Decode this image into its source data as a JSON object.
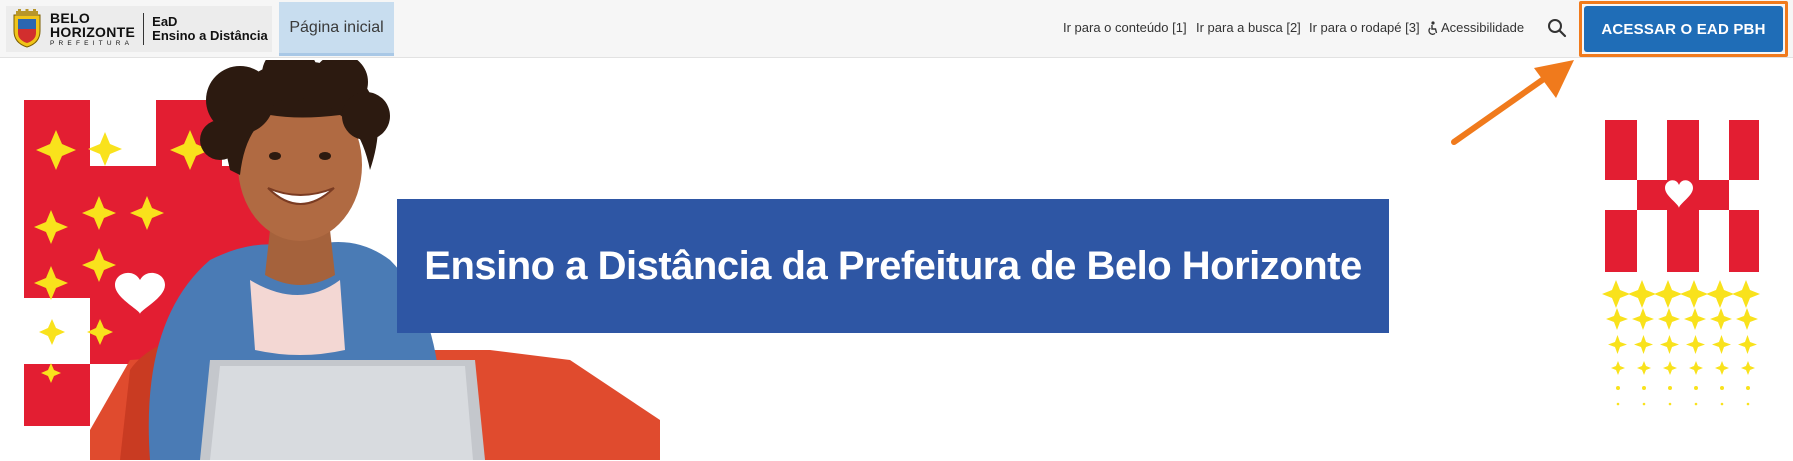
{
  "header": {
    "logo": {
      "org_line1": "BELO",
      "org_line2": "HORIZONTE",
      "org_line3": "PREFEITURA",
      "product_line1": "EaD",
      "product_line2": "Ensino a Distância"
    },
    "home_tab": "Página inicial",
    "quick_links": [
      "Ir para o conteúdo [1]",
      "Ir para a busca [2]",
      "Ir para o rodapé [3]"
    ],
    "accessibility_label": "Acessibilidade",
    "cta_label": "ACESSAR O EAD PBH"
  },
  "hero": {
    "title": "Ensino a Distância da Prefeitura de Belo Horizonte"
  },
  "colors": {
    "accent_blue": "#1f6db7",
    "banner_blue": "#2e56a4",
    "highlight_orange": "#f07a1c",
    "pattern_red": "#e31e32",
    "pattern_yellow": "#f9e21c"
  },
  "icons": [
    "city-crest-icon",
    "accessibility-icon",
    "search-icon",
    "arrow-annotation-icon",
    "heart-icon"
  ]
}
